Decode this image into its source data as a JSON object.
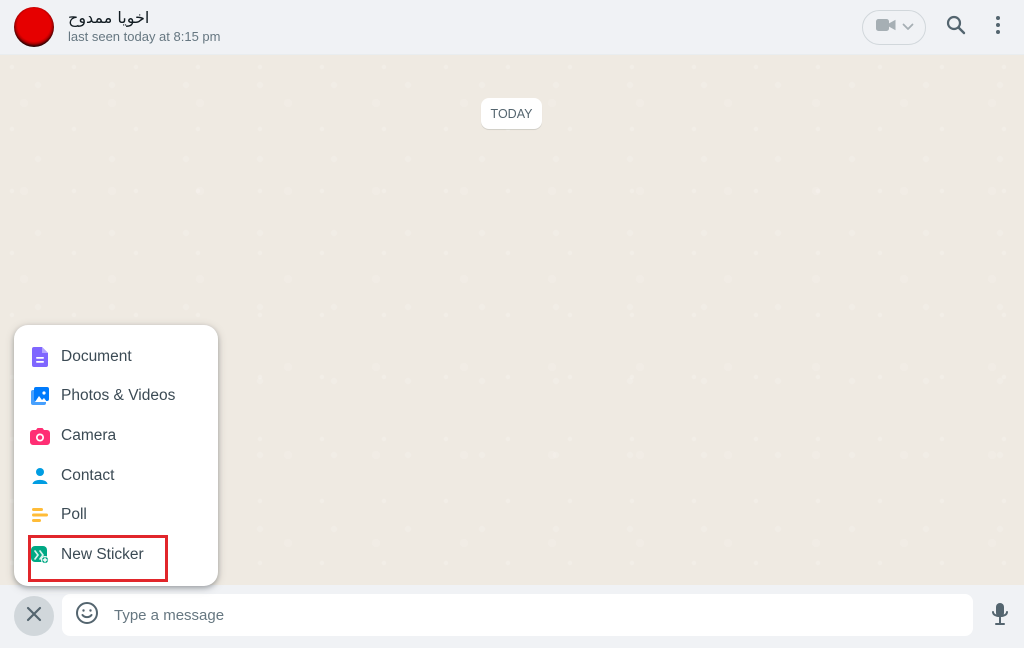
{
  "header": {
    "contact_name": "اخويا ممدوح",
    "last_seen": "last seen today at 8:15 pm",
    "icons": {
      "video": "video-camera-icon",
      "search": "search-icon",
      "menu": "vertical-dots-icon"
    }
  },
  "chat": {
    "date_chip": "TODAY"
  },
  "attach_menu": {
    "items": [
      {
        "label": "Document",
        "icon": "document-icon",
        "color": "#7f66ff"
      },
      {
        "label": "Photos & Videos",
        "icon": "photos-videos-icon",
        "color": "#007bfc"
      },
      {
        "label": "Camera",
        "icon": "camera-icon",
        "color": "#ff2e74"
      },
      {
        "label": "Contact",
        "icon": "contact-icon",
        "color": "#009de2"
      },
      {
        "label": "Poll",
        "icon": "poll-icon",
        "color": "#ffbc38"
      },
      {
        "label": "New Sticker",
        "icon": "new-sticker-icon",
        "color": "#00a884"
      }
    ],
    "highlight_color": "#e1262b"
  },
  "composer": {
    "placeholder": "Type a message",
    "value": "",
    "icons": {
      "close": "close-icon",
      "emoji": "emoji-icon",
      "mic": "microphone-icon"
    }
  },
  "colors": {
    "header_bg": "#f0f2f5",
    "chat_bg": "#efeae2",
    "primary_text": "#111b21",
    "secondary_text": "#667781"
  }
}
